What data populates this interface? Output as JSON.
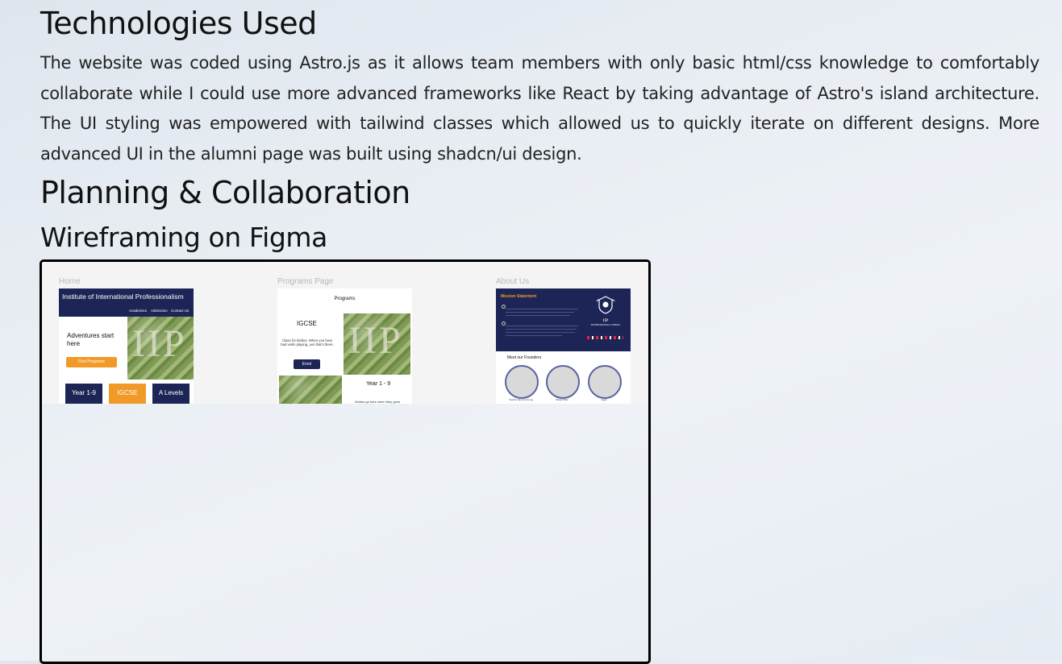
{
  "tech": {
    "title": "Technologies Used",
    "paragraph": "The website was coded using Astro.js as it allows team members with only basic html/css knowledge to comfortably collaborate while I could use more advanced frameworks like React by taking advantage of Astro's island architecture. The UI styling was empowered with tailwind classes which allowed us to quickly iterate on different designs. More advanced UI in the alumni page was built using shadcn/ui design."
  },
  "planning": {
    "title": "Planning & Collaboration"
  },
  "wireframing": {
    "title": "Wireframing on Figma"
  },
  "figma": {
    "home": {
      "label": "Home",
      "header": "Institute of International Professionalism",
      "nav": [
        "Academics",
        "Admission",
        "Contact Us"
      ],
      "hero": "Adventures start here",
      "cta": "Find Programs",
      "image_text": "IIP",
      "tiles": [
        "Year 1-9",
        "IGCSE",
        "A Levels"
      ]
    },
    "programs": {
      "label": "Programs Page",
      "title": "Programs",
      "program1": "IGCSE",
      "desc": "Class for kiddos. When you hear bad violin playing, yes that's there.",
      "button": "Enrol",
      "program2": "Year 1 - 9",
      "desc2": "Kiddos go here when they grow",
      "image_text": "IIP"
    },
    "about": {
      "label": "About Us",
      "mission": "Mission Statement",
      "crest_text": "IIP",
      "school_name": "INTERNATIONAL SCHOOL",
      "founders_title": "Meet our Founders",
      "founders": [
        "Teacher Kar-Ann Foong",
        "Razali Tikha",
        "Anjali"
      ]
    }
  }
}
